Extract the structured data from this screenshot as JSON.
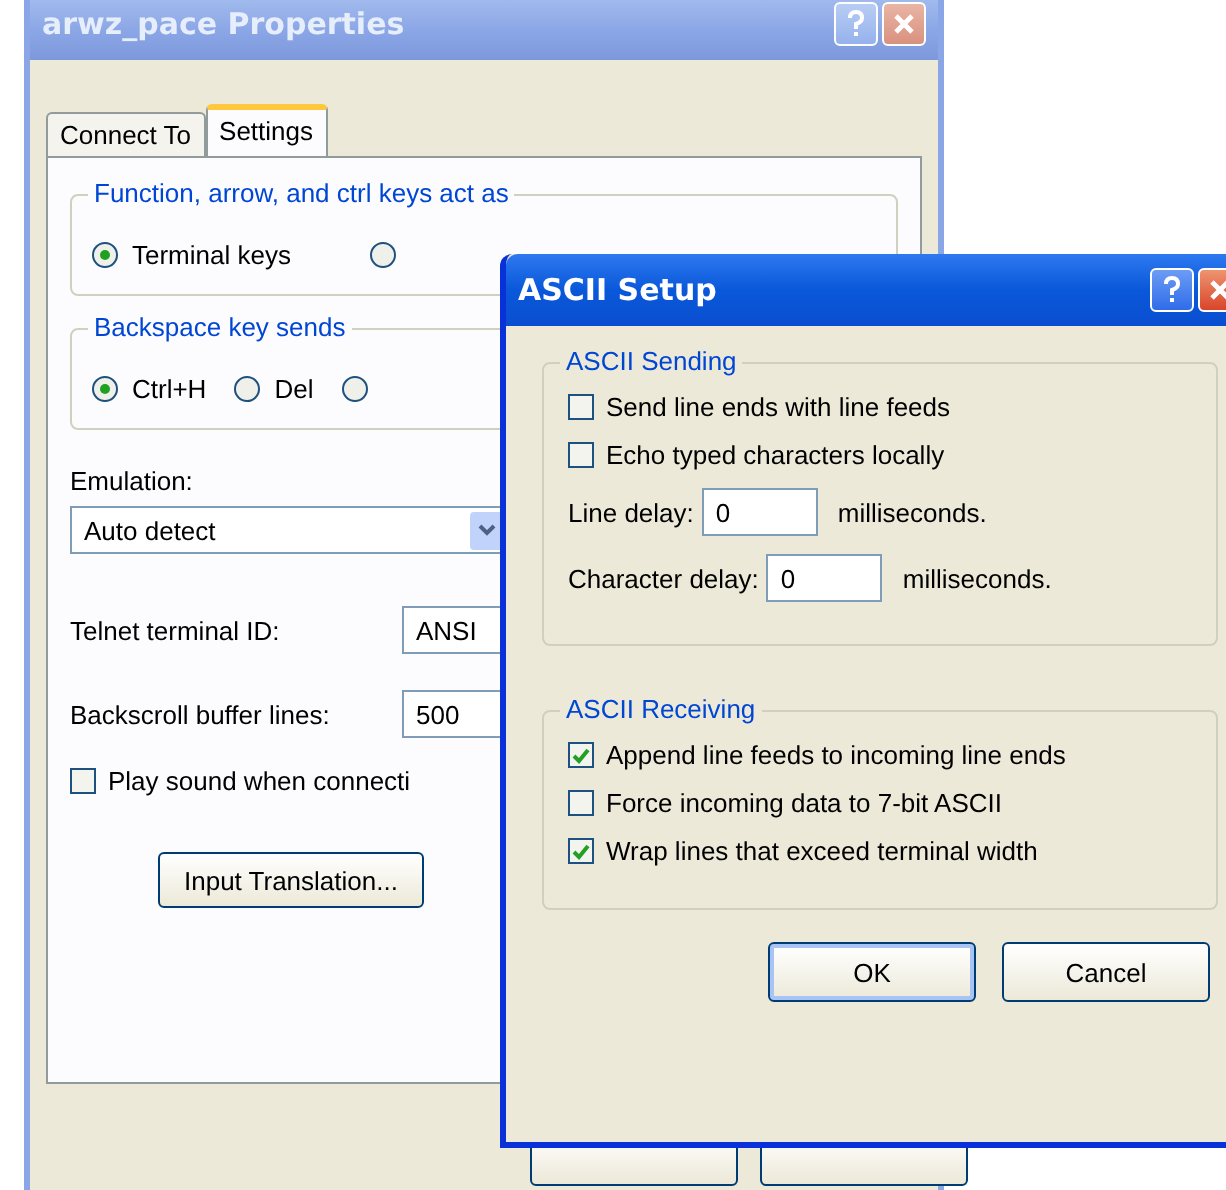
{
  "properties_window": {
    "title": "arwz_pace Properties",
    "tabs": [
      {
        "label": "Connect To",
        "selected": false
      },
      {
        "label": "Settings",
        "selected": true
      }
    ],
    "key_group": {
      "title": "Function, arrow, and ctrl keys act as",
      "options": [
        {
          "label": "Terminal keys",
          "selected": true
        },
        {
          "selected": false
        }
      ]
    },
    "backspace_group": {
      "title": "Backspace key sends",
      "options": [
        {
          "label": "Ctrl+H",
          "selected": true
        },
        {
          "label": "Del",
          "selected": false
        },
        {
          "selected": false
        }
      ]
    },
    "emulation": {
      "label": "Emulation:",
      "value": "Auto detect"
    },
    "telnet_id": {
      "label": "Telnet terminal ID:",
      "value": "ANSI"
    },
    "backscroll": {
      "label": "Backscroll buffer lines:",
      "value": "500"
    },
    "play_sound": {
      "label": "Play sound when connecti",
      "checked": false
    },
    "input_translation_button": "Input Translation..."
  },
  "ascii_setup": {
    "title": "ASCII Setup",
    "sending": {
      "title": "ASCII Sending",
      "options": [
        {
          "label": "Send line ends with line feeds",
          "checked": false
        },
        {
          "label": "Echo typed characters locally",
          "checked": false
        }
      ],
      "delays": [
        {
          "label": "Line delay:",
          "value": "0",
          "unit": "milliseconds."
        },
        {
          "label": "Character delay:",
          "value": "0",
          "unit": "milliseconds."
        }
      ]
    },
    "receiving": {
      "title": "ASCII Receiving",
      "options": [
        {
          "label": "Append line feeds to incoming line ends",
          "checked": true
        },
        {
          "label": "Force incoming data to 7-bit ASCII",
          "checked": false
        },
        {
          "label": "Wrap lines that exceed terminal width",
          "checked": true
        }
      ]
    },
    "buttons": [
      "OK",
      "Cancel"
    ]
  }
}
